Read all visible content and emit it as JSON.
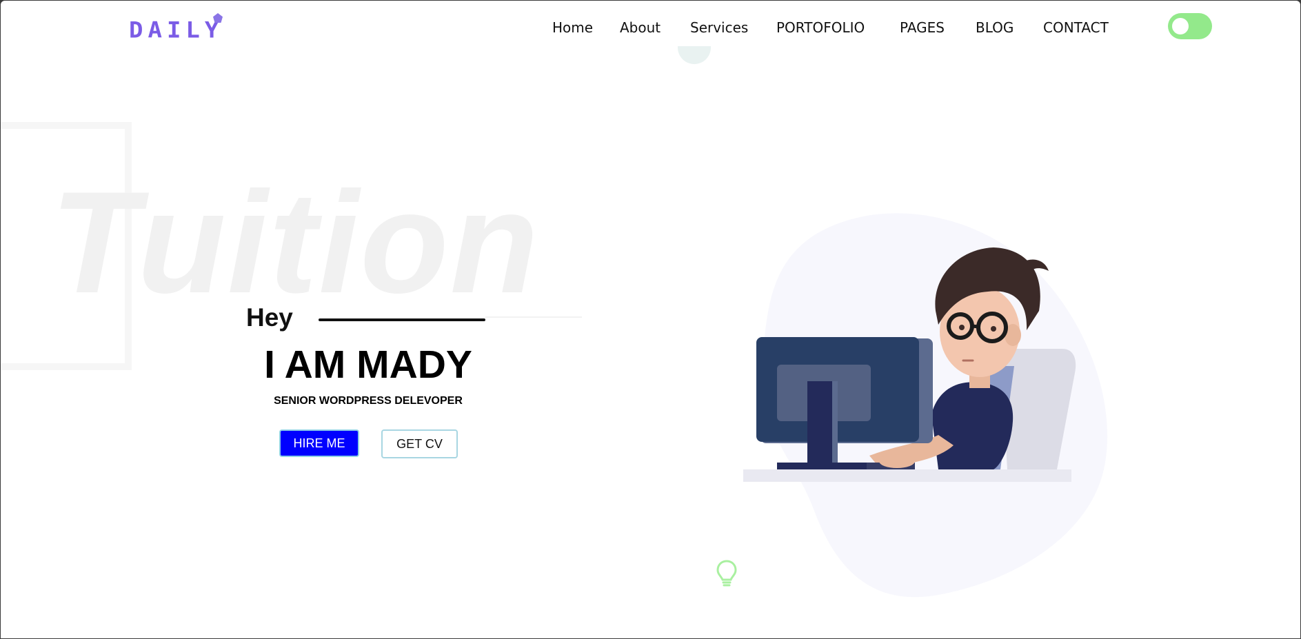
{
  "header": {
    "logo_text": "DAILY",
    "nav": [
      {
        "label": "Home"
      },
      {
        "label": "About"
      },
      {
        "label": "Services"
      },
      {
        "label": "PORTOFOLIO"
      },
      {
        "label": "PAGES"
      },
      {
        "label": "BLOG"
      },
      {
        "label": "CONTACT"
      }
    ],
    "theme_toggle": {
      "state": "off",
      "color": "#93e98b"
    }
  },
  "hero": {
    "background_word": "Tuition",
    "greeting": "Hey",
    "headline": "I AM MADY",
    "role": "SENIOR WORDPRESS DELEVOPER",
    "buttons": {
      "hire_label": "HIRE ME",
      "cv_label": "GET CV"
    }
  },
  "colors": {
    "logo": "#7b5ce6",
    "hire_button": "#0000ff",
    "toggle": "#93e98b",
    "blob": "#f7f7fd",
    "bulb": "#a9f0a0"
  },
  "icons": {
    "logo_mark": "pentagon-icon",
    "decor": "lightbulb-icon",
    "illustration": "developer-at-computer-illustration"
  }
}
